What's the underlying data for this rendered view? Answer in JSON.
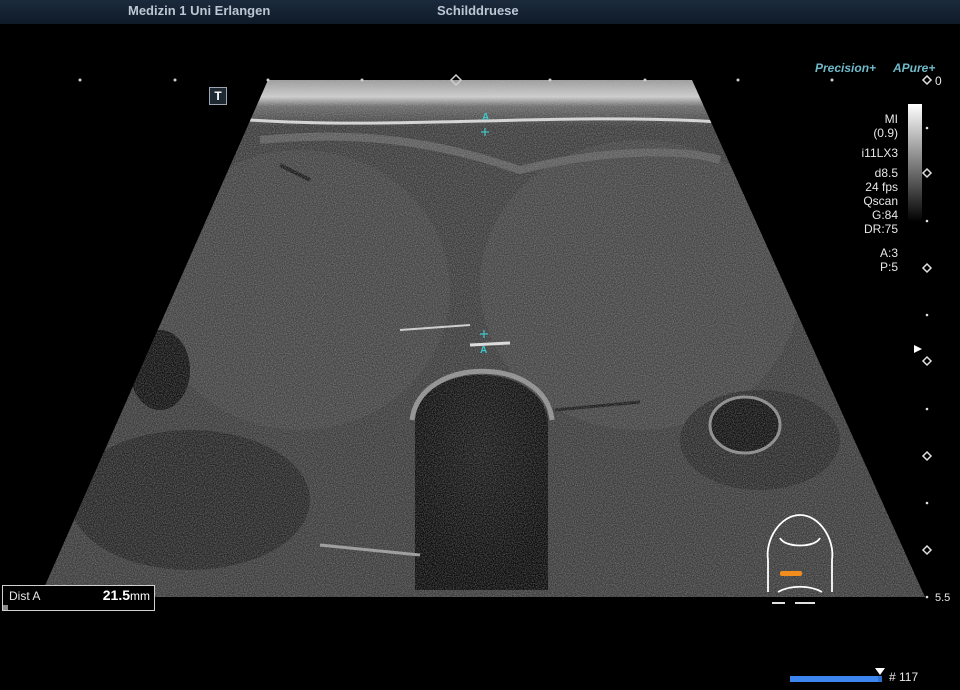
{
  "header": {
    "institution": "Medizin 1 Uni Erlangen",
    "exam": "Schilddruese"
  },
  "branding": {
    "precision": "Precision+",
    "apure": "APure+"
  },
  "parameters": {
    "mi_label": "MI",
    "mi_value": "(0.9)",
    "transducer": "i11LX3",
    "depth": "d8.5",
    "frame_rate": "24 fps",
    "qscan": "Qscan",
    "gain": "G:84",
    "dynamic_range": "DR:75",
    "a_value": "A:3",
    "p_value": "P:5"
  },
  "depth_scale": {
    "top": "0",
    "bottom": "5.5"
  },
  "mode_icon": "T",
  "measurement": {
    "name": "Dist A",
    "value": "21.5",
    "unit": "mm"
  },
  "calipers": {
    "top_label": "A",
    "bottom_label": "A"
  },
  "cine": {
    "frame_label": "# 117",
    "progress_fraction": 0.96
  },
  "colors": {
    "caliper": "#3fc7c9",
    "brand": "#6fb9c9",
    "header_text": "#bcc6d4",
    "bodymark_probe": "#f28c1c",
    "progress_bar": "#2f6fcf"
  },
  "icons": {
    "mode_icon": "t-mode-icon",
    "focus_marker": "focus-arrow-icon",
    "body_mark": "neck-bodymark-icon"
  }
}
